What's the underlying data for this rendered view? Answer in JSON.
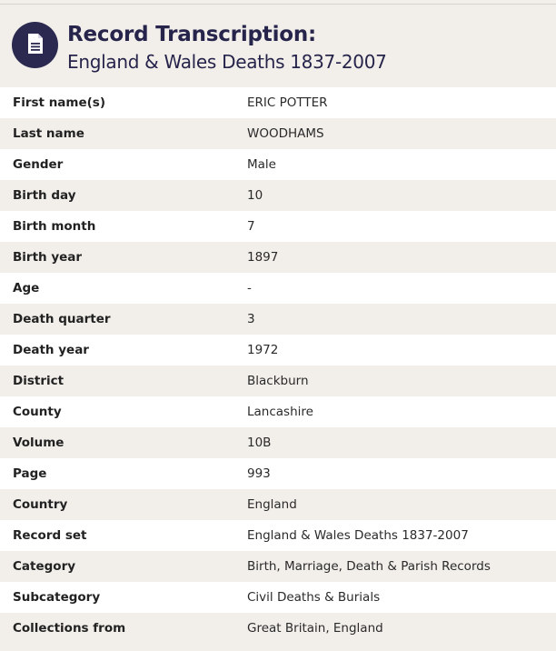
{
  "header": {
    "title": "Record Transcription:",
    "subtitle": "England & Wales Deaths 1837-2007",
    "icon": "document-icon",
    "badge_color": "#2b2950"
  },
  "rows": [
    {
      "label": "First name(s)",
      "value": "ERIC POTTER"
    },
    {
      "label": "Last name",
      "value": "WOODHAMS"
    },
    {
      "label": "Gender",
      "value": "Male"
    },
    {
      "label": "Birth day",
      "value": "10"
    },
    {
      "label": "Birth month",
      "value": "7"
    },
    {
      "label": "Birth year",
      "value": "1897"
    },
    {
      "label": "Age",
      "value": "-"
    },
    {
      "label": "Death quarter",
      "value": "3"
    },
    {
      "label": "Death year",
      "value": "1972"
    },
    {
      "label": "District",
      "value": "Blackburn"
    },
    {
      "label": "County",
      "value": "Lancashire"
    },
    {
      "label": "Volume",
      "value": "10B"
    },
    {
      "label": "Page",
      "value": "993"
    },
    {
      "label": "Country",
      "value": "England"
    },
    {
      "label": "Record set",
      "value": "England & Wales Deaths 1837-2007"
    },
    {
      "label": "Category",
      "value": "Birth, Marriage, Death & Parish Records"
    },
    {
      "label": "Subcategory",
      "value": "Civil Deaths & Burials"
    },
    {
      "label": "Collections from",
      "value": "Great Britain, England"
    }
  ]
}
